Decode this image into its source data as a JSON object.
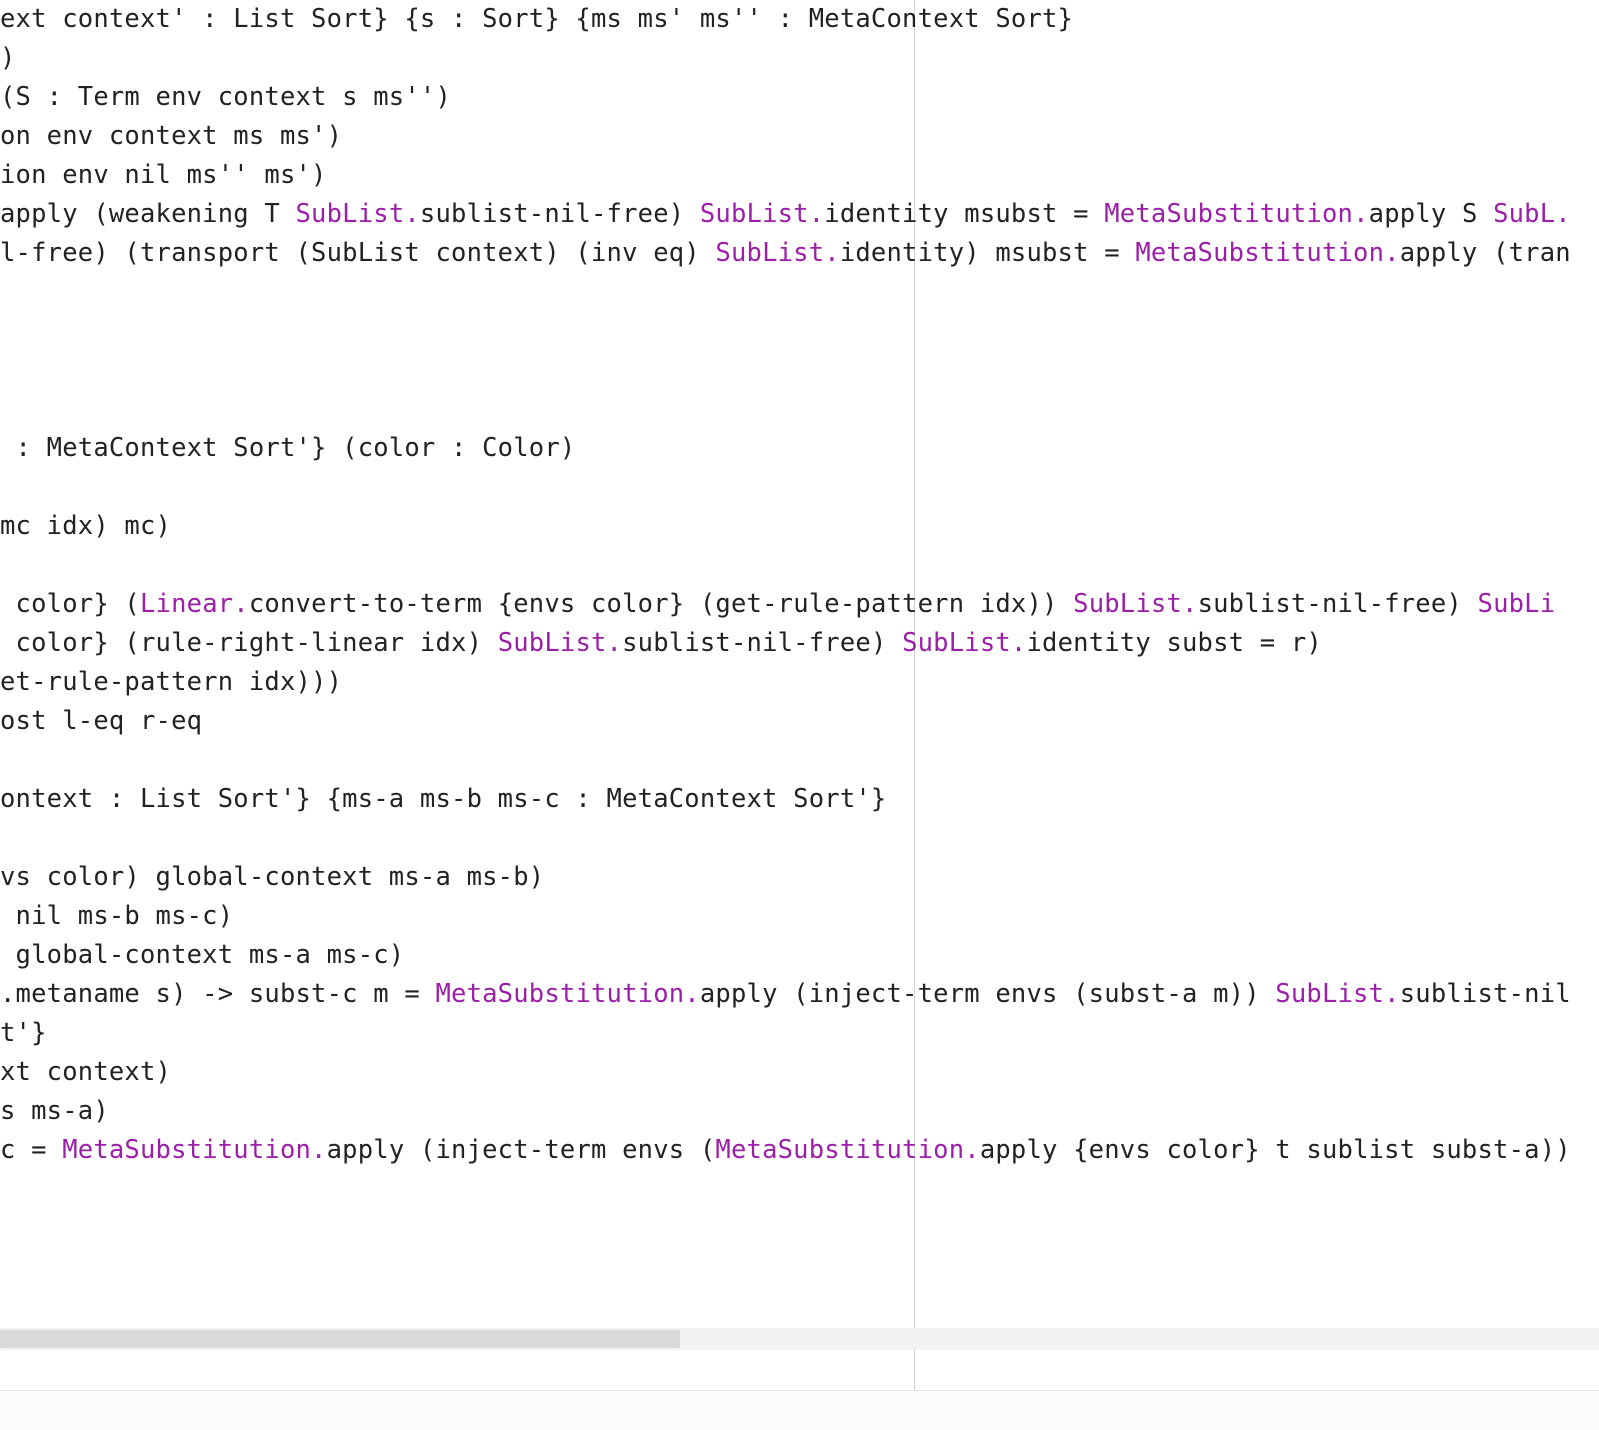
{
  "code": {
    "lines": [
      {
        "indent": 0,
        "segments": [
          {
            "t": "ext context' : List Sort} {s : Sort} {ms ms' ms'' : MetaContext Sort}"
          }
        ]
      },
      {
        "indent": 0,
        "segments": [
          {
            "t": ")"
          }
        ]
      },
      {
        "indent": 0,
        "segments": [
          {
            "t": "(S : Term env context s ms'')"
          }
        ]
      },
      {
        "indent": 0,
        "segments": [
          {
            "t": "on env context ms ms')"
          }
        ]
      },
      {
        "indent": 0,
        "segments": [
          {
            "t": "ion env nil ms'' ms')"
          }
        ]
      },
      {
        "indent": 0,
        "segments": [
          {
            "t": "apply (weakening T "
          },
          {
            "t": "SubList.",
            "c": "kw"
          },
          {
            "t": "sublist-nil-free) "
          },
          {
            "t": "SubList.",
            "c": "kw"
          },
          {
            "t": "identity msubst = "
          },
          {
            "t": "MetaSubstitution.",
            "c": "kw"
          },
          {
            "t": "apply S "
          },
          {
            "t": "SubL.",
            "c": "kw"
          }
        ]
      },
      {
        "indent": 0,
        "segments": [
          {
            "t": "l-free) (transport (SubList context) (inv eq) "
          },
          {
            "t": "SubList.",
            "c": "kw"
          },
          {
            "t": "identity) msubst = "
          },
          {
            "t": "MetaSubstitution.",
            "c": "kw"
          },
          {
            "t": "apply (tran"
          }
        ]
      },
      {
        "indent": 0,
        "segments": [
          {
            "t": ""
          }
        ]
      },
      {
        "indent": 0,
        "segments": [
          {
            "t": ""
          }
        ]
      },
      {
        "indent": 0,
        "segments": [
          {
            "t": ""
          }
        ]
      },
      {
        "indent": 0,
        "segments": [
          {
            "t": ""
          }
        ]
      },
      {
        "indent": 0,
        "segments": [
          {
            "t": " : MetaContext Sort'} (color : Color)"
          }
        ]
      },
      {
        "indent": 0,
        "segments": [
          {
            "t": ""
          }
        ]
      },
      {
        "indent": 0,
        "segments": [
          {
            "t": "mc idx) mc)"
          }
        ]
      },
      {
        "indent": 0,
        "segments": [
          {
            "t": ""
          }
        ]
      },
      {
        "indent": 0,
        "segments": [
          {
            "t": " color} ("
          },
          {
            "t": "Linear.",
            "c": "kw"
          },
          {
            "t": "convert-to-term {envs color} (get-rule-pattern idx)) "
          },
          {
            "t": "SubList.",
            "c": "kw"
          },
          {
            "t": "sublist-nil-free) "
          },
          {
            "t": "SubLi",
            "c": "kw"
          }
        ]
      },
      {
        "indent": 0,
        "segments": [
          {
            "t": " color} (rule-right-linear idx) "
          },
          {
            "t": "SubList.",
            "c": "kw"
          },
          {
            "t": "sublist-nil-free) "
          },
          {
            "t": "SubList.",
            "c": "kw"
          },
          {
            "t": "identity subst = r)"
          }
        ]
      },
      {
        "indent": 0,
        "segments": [
          {
            "t": "et-rule-pattern idx)))"
          }
        ]
      },
      {
        "indent": 0,
        "segments": [
          {
            "t": "ost l-eq r-eq"
          }
        ]
      },
      {
        "indent": 0,
        "segments": [
          {
            "t": ""
          }
        ]
      },
      {
        "indent": 0,
        "segments": [
          {
            "t": "ontext : List Sort'} {ms-a ms-b ms-c : MetaContext Sort'}"
          }
        ]
      },
      {
        "indent": 0,
        "segments": [
          {
            "t": ""
          }
        ]
      },
      {
        "indent": 0,
        "segments": [
          {
            "t": "vs color) global-context ms-a ms-b)"
          }
        ]
      },
      {
        "indent": 0,
        "segments": [
          {
            "t": " nil ms-b ms-c)"
          }
        ]
      },
      {
        "indent": 0,
        "segments": [
          {
            "t": " global-context ms-a ms-c)"
          }
        ]
      },
      {
        "indent": 0,
        "segments": [
          {
            "t": ".metaname s) -> subst-c m = "
          },
          {
            "t": "MetaSubstitution.",
            "c": "kw"
          },
          {
            "t": "apply (inject-term envs (subst-a m)) "
          },
          {
            "t": "SubList.",
            "c": "kw"
          },
          {
            "t": "sublist-nil"
          }
        ]
      },
      {
        "indent": 0,
        "segments": [
          {
            "t": "t'}"
          }
        ]
      },
      {
        "indent": 0,
        "segments": [
          {
            "t": "xt context)"
          }
        ]
      },
      {
        "indent": 0,
        "segments": [
          {
            "t": "s ms-a)"
          }
        ]
      },
      {
        "indent": 0,
        "segments": [
          {
            "t": "c = "
          },
          {
            "t": "MetaSubstitution.",
            "c": "kw"
          },
          {
            "t": "apply (inject-term envs ("
          },
          {
            "t": "MetaSubstitution.",
            "c": "kw"
          },
          {
            "t": "apply {envs color} t sublist subst-a))"
          }
        ]
      }
    ]
  },
  "ruler_column": 60,
  "scrollbar": {
    "thumb_fraction": 0.425
  }
}
